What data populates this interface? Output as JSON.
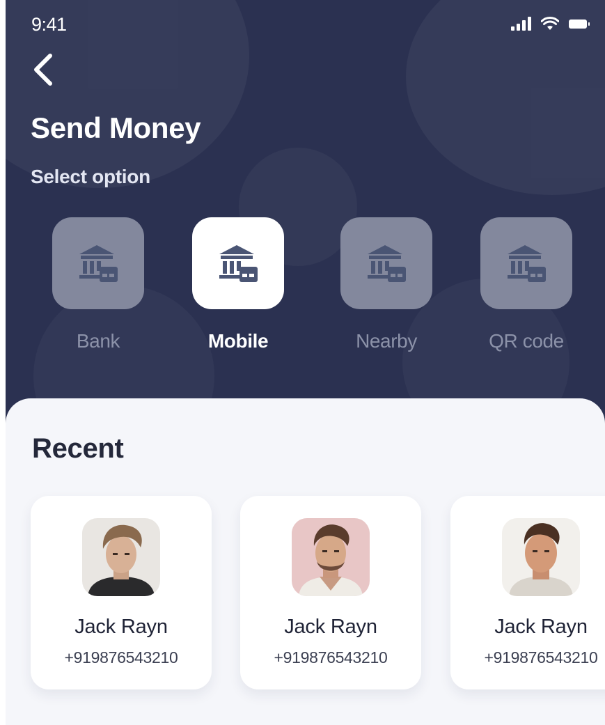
{
  "status_bar": {
    "time": "9:41"
  },
  "header": {
    "title": "Send Money",
    "subtitle": "Select option"
  },
  "options": [
    {
      "label": "Bank",
      "icon": "bank-icon",
      "selected": false
    },
    {
      "label": "Mobile",
      "icon": "bank-icon",
      "selected": true
    },
    {
      "label": "Nearby",
      "icon": "bank-icon",
      "selected": false
    },
    {
      "label": "QR code",
      "icon": "bank-icon",
      "selected": false
    }
  ],
  "recent": {
    "title": "Recent",
    "contacts": [
      {
        "name": "Jack Rayn",
        "phone": "+919876543210"
      },
      {
        "name": "Jack Rayn",
        "phone": "+919876543210"
      },
      {
        "name": "Jack Rayn",
        "phone": "+919876543210"
      }
    ]
  },
  "colors": {
    "header_bg": "#2b3151",
    "tile_inactive": "#83889d",
    "tile_active": "#ffffff",
    "icon": "#4a5574",
    "sheet_bg": "#f5f6fa"
  }
}
